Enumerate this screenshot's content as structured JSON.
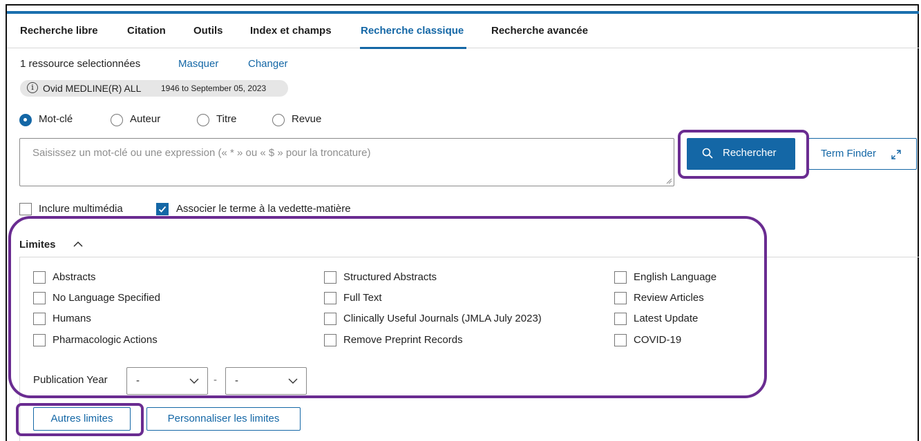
{
  "tabs": [
    {
      "label": "Recherche libre"
    },
    {
      "label": "Citation"
    },
    {
      "label": "Outils"
    },
    {
      "label": "Index et champs"
    },
    {
      "label": "Recherche classique"
    },
    {
      "label": "Recherche avancée"
    }
  ],
  "active_tab": "Recherche classique",
  "resources": {
    "selected_text": "1 ressource selectionnées",
    "hide_link": "Masquer",
    "change_link": "Changer",
    "database_name": "Ovid MEDLINE(R) ALL",
    "database_range": "1946 to September 05, 2023",
    "info_symbol": "i"
  },
  "search_modes": {
    "selected": "Mot-clé",
    "options": [
      {
        "label": "Mot-clé"
      },
      {
        "label": "Auteur"
      },
      {
        "label": "Titre"
      },
      {
        "label": "Revue"
      }
    ]
  },
  "search": {
    "placeholder": "Saisissez un mot-clé ou une expression (« * » ou « $ » pour la troncature)",
    "value": "",
    "search_button": "Rechercher",
    "term_finder_button": "Term Finder"
  },
  "options": {
    "include_multimedia": {
      "label": "Inclure multimédia",
      "checked": false
    },
    "map_term": {
      "label": "Associer le terme à la vedette-matière",
      "checked": true
    }
  },
  "limits": {
    "heading": "Limites",
    "expanded": true,
    "items": [
      {
        "label": "Abstracts",
        "checked": false
      },
      {
        "label": "No Language Specified",
        "checked": false
      },
      {
        "label": "Humans",
        "checked": false
      },
      {
        "label": "Pharmacologic Actions",
        "checked": false
      },
      {
        "label": "Structured Abstracts",
        "checked": false
      },
      {
        "label": "Full Text",
        "checked": false
      },
      {
        "label": "Clinically Useful Journals (JMLA July 2023)",
        "checked": false
      },
      {
        "label": "Remove Preprint Records",
        "checked": false
      },
      {
        "label": "English Language",
        "checked": false
      },
      {
        "label": "Review Articles",
        "checked": false
      },
      {
        "label": "Latest Update",
        "checked": false
      },
      {
        "label": "COVID-19",
        "checked": false
      }
    ],
    "publication_year": {
      "label": "Publication Year",
      "from": "-",
      "separator": "-",
      "to": "-"
    }
  },
  "buttons": {
    "more_limits": "Autres limites",
    "customize_limits": "Personnaliser les limites"
  },
  "colors": {
    "accent": "#1467a6",
    "highlight": "#6a2c91"
  }
}
